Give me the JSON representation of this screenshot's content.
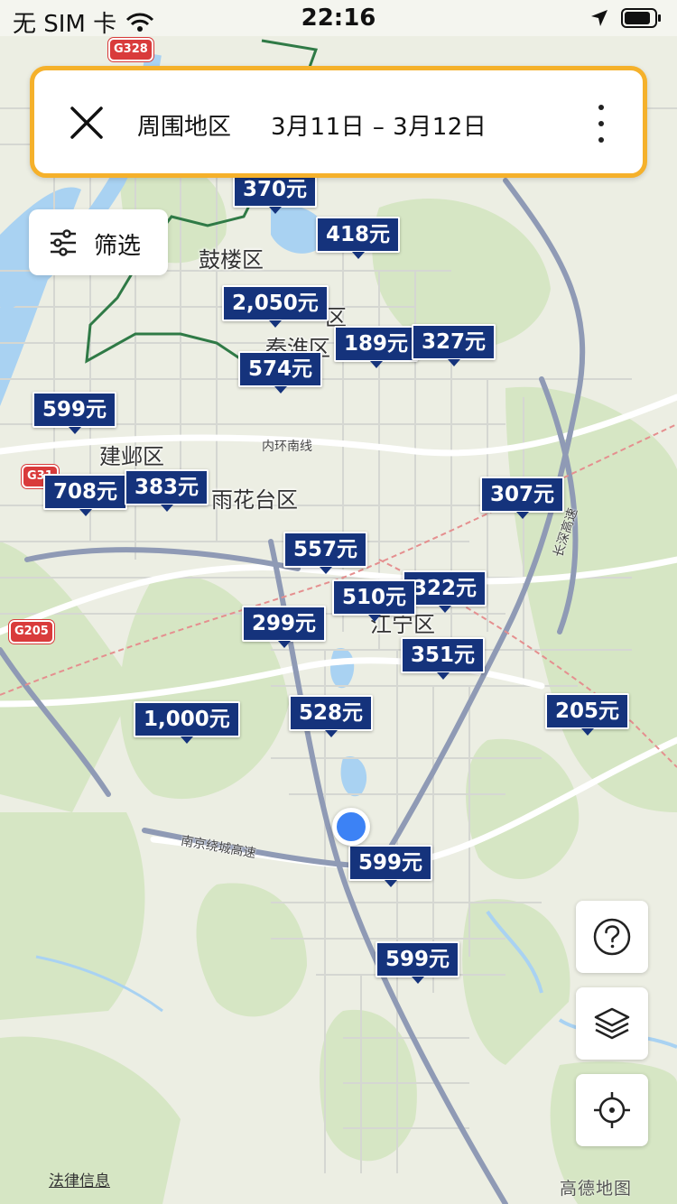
{
  "status_bar": {
    "carrier": "无 SIM 卡",
    "time": "22:16"
  },
  "search": {
    "area": "周围地区",
    "dates": "3月11日 – 3月12日"
  },
  "filter": {
    "label": "筛选"
  },
  "districts": [
    "鼓楼区",
    "区",
    "秦淮区",
    "建邺区",
    "雨花台区",
    "江宁区"
  ],
  "roads": [
    "内环南线",
    "南京绕城高速",
    "长深高速"
  ],
  "shields": [
    "G328",
    "G31",
    "G205"
  ],
  "prices": [
    "370元",
    "418元",
    "2,050元",
    "189元",
    "327元",
    "574元",
    "599元",
    "708元",
    "383元",
    "307元",
    "557元",
    "510元",
    "322元",
    "299元",
    "351元",
    "1,000元",
    "528元",
    "205元",
    "599元",
    "599元"
  ],
  "footer": {
    "legal": "法律信息",
    "logo": "高德地图"
  },
  "colors": {
    "pin": "#15337c",
    "accent_border": "#f5b12b",
    "location": "#3c82f5"
  }
}
